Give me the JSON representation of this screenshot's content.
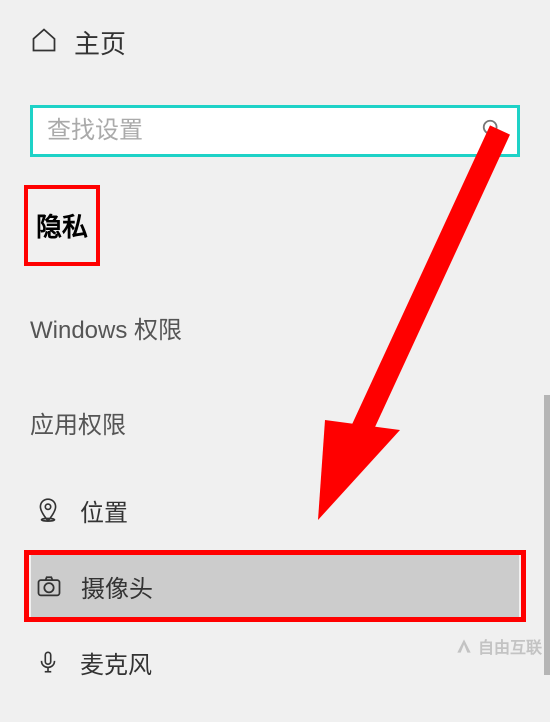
{
  "home": {
    "label": "主页"
  },
  "search": {
    "placeholder": "查找设置",
    "value": ""
  },
  "category": {
    "label": "隐私"
  },
  "sections": {
    "windows_permissions": "Windows 权限",
    "app_permissions": "应用权限"
  },
  "nav": {
    "location": "位置",
    "camera": "摄像头",
    "microphone": "麦克风"
  },
  "watermark": "自由互联",
  "colors": {
    "highlight": "#ff0000",
    "search_border": "#1ed2c7"
  }
}
